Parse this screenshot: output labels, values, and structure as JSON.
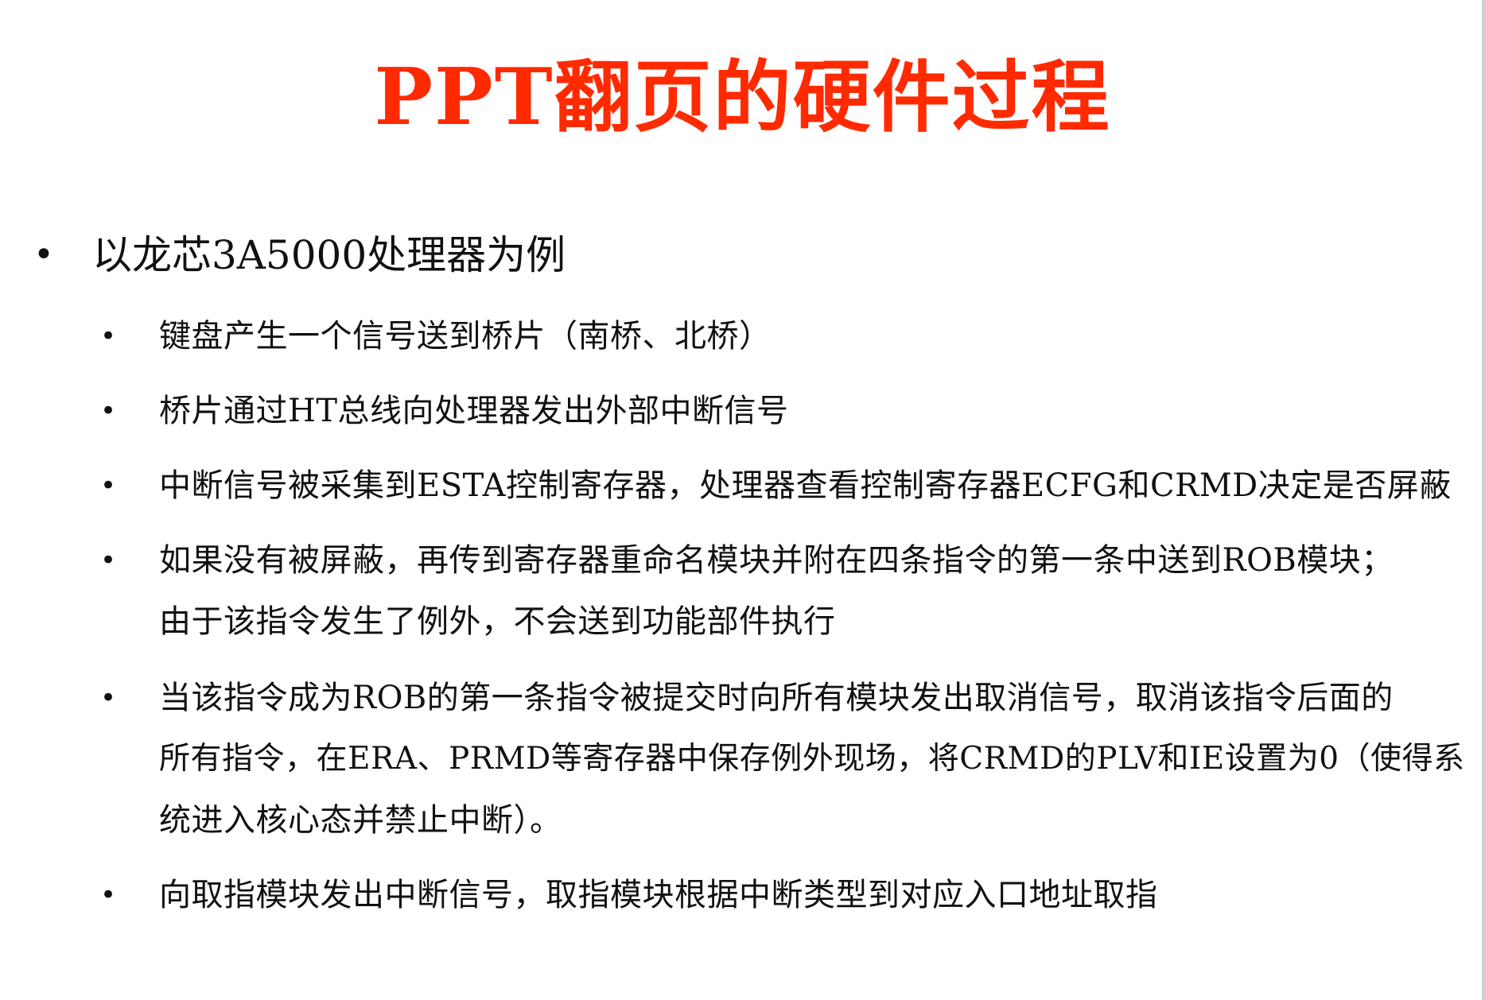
{
  "slide": {
    "title": "PPT翻页的硬件过程",
    "main_bullet": "以龙芯3A5000处理器为例",
    "sub_bullets": [
      {
        "lines": [
          "键盘产生一个信号送到桥片（南桥、北桥）"
        ]
      },
      {
        "lines": [
          "桥片通过HT总线向处理器发出外部中断信号"
        ]
      },
      {
        "lines": [
          "中断信号被采集到ESTA控制寄存器，处理器查看控制寄存器ECFG和CRMD决定是否屏蔽"
        ]
      },
      {
        "lines": [
          "如果没有被屏蔽，再传到寄存器重命名模块并附在四条指令的第一条中送到ROB模块；",
          "由于该指令发生了例外，不会送到功能部件执行"
        ]
      },
      {
        "lines": [
          "当该指令成为ROB的第一条指令被提交时向所有模块发出取消信号，取消该指令后面的",
          "所有指令，在ERA、PRMD等寄存器中保存例外现场，将CRMD的PLV和IE设置为0（使得系",
          "统进入核心态并禁止中断）。"
        ]
      },
      {
        "lines": [
          "向取指模块发出中断信号，取指模块根据中断类型到对应入口地址取指"
        ]
      }
    ],
    "bullet_symbol": "•",
    "title_color": "#ff2a00"
  }
}
